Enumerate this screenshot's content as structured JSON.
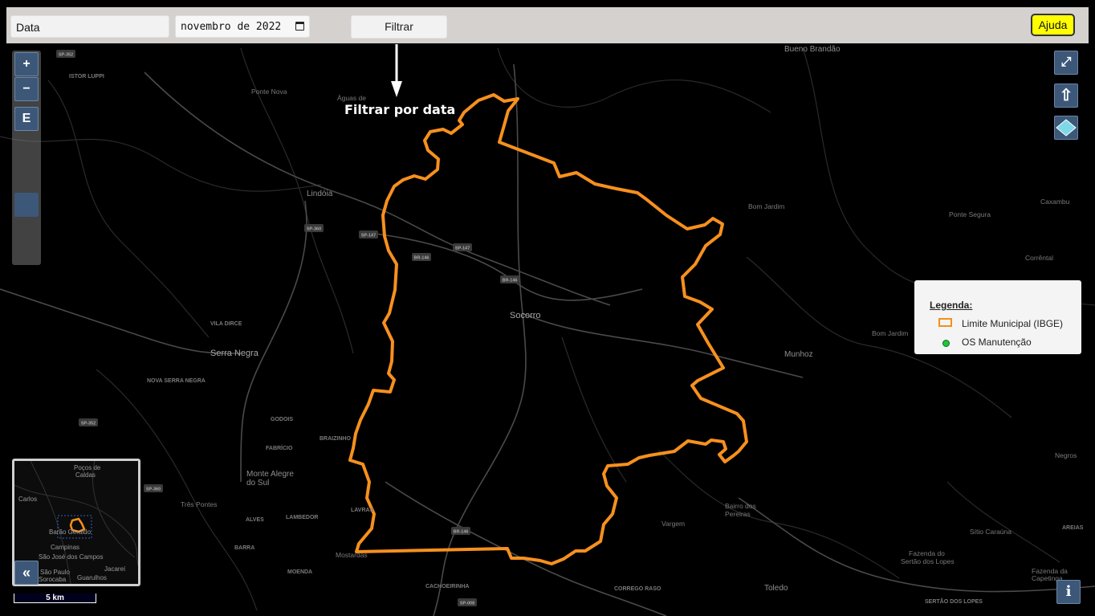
{
  "toolbar": {
    "date_label": "Data",
    "month_value": "novembro de 2022",
    "filter_label": "Filtrar",
    "help_label": "Ajuda"
  },
  "controls": {
    "zoom_in": "+",
    "zoom_out": "−",
    "extent": "E",
    "fullscreen": "⤢",
    "upload": "⇧",
    "info": "i",
    "overview_toggle": "«"
  },
  "annotation": {
    "text": "Filtrar por data"
  },
  "legend": {
    "title": "Legenda:",
    "items": [
      {
        "label": "Limite Municipal (IBGE)",
        "color": "#f39019"
      },
      {
        "label": "OS Manutenção",
        "color": "#21c43b"
      }
    ]
  },
  "scale_label": "5 km",
  "map": {
    "boundary_color": "#f7901e",
    "places": [
      {
        "name": "Bueno Brandão",
        "cls": "town"
      },
      {
        "name": "Ponte Nova",
        "cls": "small"
      },
      {
        "name": "Águas de",
        "cls": "small"
      },
      {
        "name": "Lindóia",
        "cls": "town"
      },
      {
        "name": "Bom Jardim",
        "cls": "small"
      },
      {
        "name": "Ponte Segura",
        "cls": "small"
      },
      {
        "name": "Caxambu",
        "cls": "small"
      },
      {
        "name": "Corrêntal",
        "cls": "small"
      },
      {
        "name": "Socorro",
        "cls": "city"
      },
      {
        "name": "VILA DIRCE",
        "cls": "district"
      },
      {
        "name": "Serra Negra",
        "cls": "city"
      },
      {
        "name": "NOVA SERRA NEGRA",
        "cls": "district"
      },
      {
        "name": "GODOIS",
        "cls": "district"
      },
      {
        "name": "FABRÍCIO",
        "cls": "district"
      },
      {
        "name": "BRAIZINHO",
        "cls": "district"
      },
      {
        "name": "Monte Alegre",
        "cls": "town"
      },
      {
        "name": "do Sul",
        "cls": "town"
      },
      {
        "name": "Três Pontes",
        "cls": "small"
      },
      {
        "name": "ALVES",
        "cls": "district"
      },
      {
        "name": "LAMBEDOR",
        "cls": "district"
      },
      {
        "name": "LAVRAS",
        "cls": "district"
      },
      {
        "name": "BARRA",
        "cls": "district"
      },
      {
        "name": "Mostardas",
        "cls": "small"
      },
      {
        "name": "MOENDA",
        "cls": "district"
      },
      {
        "name": "CACHOEIRINHA",
        "cls": "district"
      },
      {
        "name": "Munhoz",
        "cls": "town"
      },
      {
        "name": "Bom Jardim",
        "cls": "small"
      },
      {
        "name": "Bairro dos",
        "cls": "small"
      },
      {
        "name": "Pereiras",
        "cls": "small"
      },
      {
        "name": "Vargem",
        "cls": "small"
      },
      {
        "name": "CORREGO RASO",
        "cls": "district"
      },
      {
        "name": "Toledo",
        "cls": "town"
      },
      {
        "name": "Sítio Caraúna",
        "cls": "small"
      },
      {
        "name": "AREIAS",
        "cls": "district"
      },
      {
        "name": "Fazenda do",
        "cls": "small"
      },
      {
        "name": "Sertão dos Lopes",
        "cls": "small"
      },
      {
        "name": "SERTÃO DOS LOPES",
        "cls": "district"
      },
      {
        "name": "Fazenda da",
        "cls": "small"
      },
      {
        "name": "Capetinga",
        "cls": "small"
      },
      {
        "name": "Negros",
        "cls": "small"
      },
      {
        "name": "ISTOR LUPPI",
        "cls": "district"
      }
    ],
    "roads": [
      "SP-352",
      "SP-360",
      "SP-147",
      "BR-146",
      "SP-147",
      "BR-146",
      "SP-352",
      "SP-360",
      "BR-146",
      "SP-008"
    ],
    "overview_places": [
      "Poços de",
      "Caldas",
      "Carlos",
      "Barão Geraldo",
      "Campinas",
      "São José dos Campos",
      "São Paulo",
      "Jacareí",
      "Sorocaba",
      "Guarulhos"
    ]
  }
}
